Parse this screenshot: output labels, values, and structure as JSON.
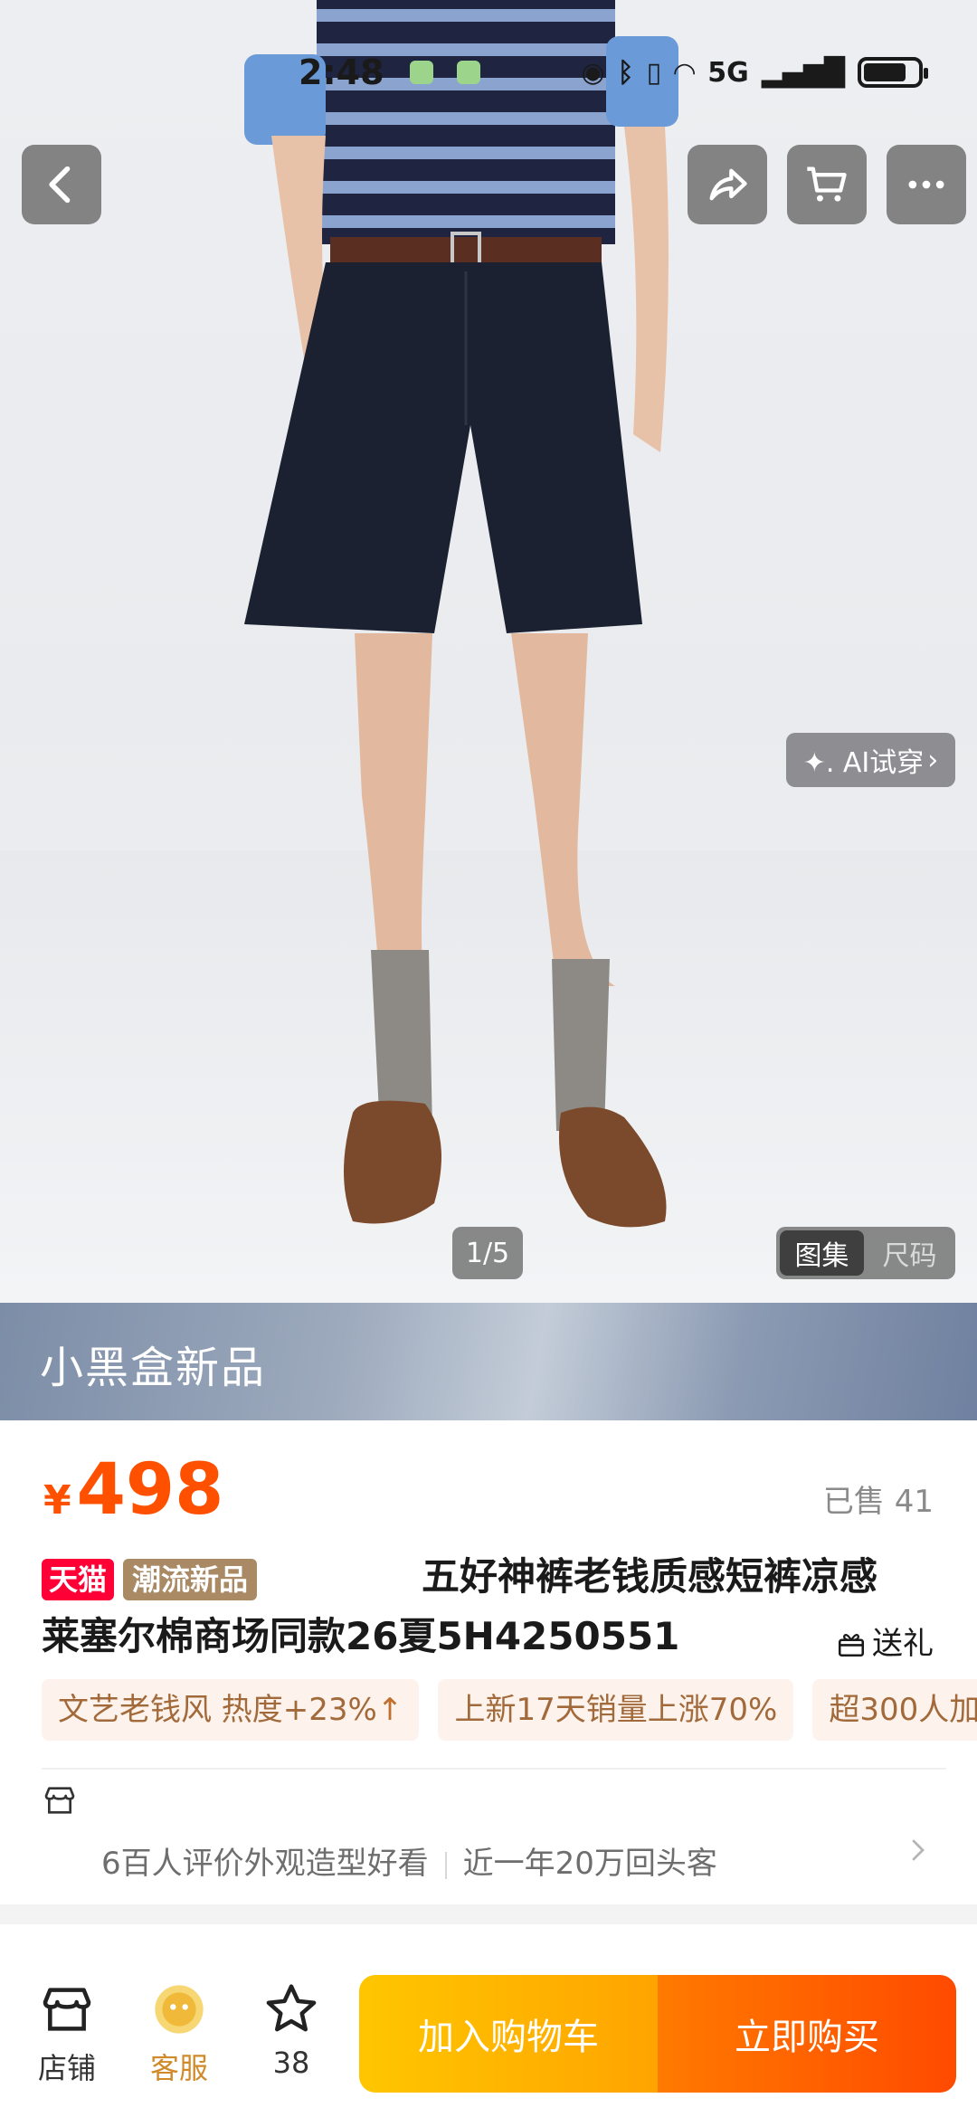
{
  "status_bar": {
    "time": "2:48",
    "network": "5G"
  },
  "hero": {
    "ai_try_on_label": "✦. AI试穿",
    "pager": "1/5",
    "tabs": [
      "图集",
      "尺码"
    ],
    "active_tab": "图集"
  },
  "banner": {
    "text": "小黑盒新品"
  },
  "product": {
    "currency": "¥",
    "price": "498",
    "sold": "已售 41",
    "tag_tmall": "天猫",
    "tag_new": "潮流新品",
    "title_line1": "五好神裤老钱质感短裤凉感",
    "title_line2": "莱塞尔棉商场同款26夏5H4250551",
    "gift_label": "送礼"
  },
  "chips": [
    {
      "text": "文艺老钱风 热度+23%",
      "arrow": "↑"
    },
    {
      "text": "上新17天销量上涨70%",
      "arrow": ""
    },
    {
      "text": "超300人加",
      "arrow": ""
    }
  ],
  "store_row": {
    "review_summary": "6百人评价外观造型好看",
    "repeat_customers": "近一年20万回头客"
  },
  "bottom_bar": {
    "shop_label": "店铺",
    "service_label": "客服",
    "favorites_count": "38",
    "add_to_cart": "加入购物车",
    "buy_now": "立即购买"
  },
  "colors": {
    "price": "#ff5000",
    "cart_button": "#ffb800",
    "buy_button": "#ff5a00",
    "tmall_tag": "#ff0036"
  }
}
